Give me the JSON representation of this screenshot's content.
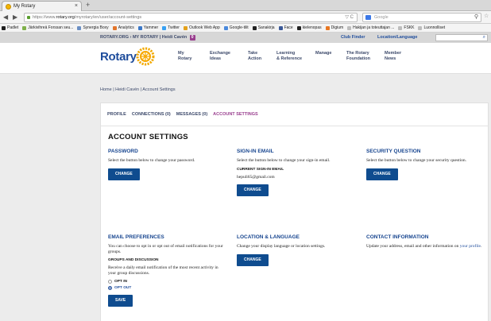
{
  "browser": {
    "tab_title": "My Rotary",
    "url_prefix": "https://www.",
    "url_host": "rotary.org",
    "url_path": "/myrotary/en/user/account-settings",
    "search_placeholder": "Google",
    "new_tab": "+",
    "close_tab": "×",
    "back": "◀",
    "forward": "▶",
    "reload": "C",
    "url_controls": "▽ C",
    "bookmarks": [
      {
        "label": "Padlet",
        "color": "#1f1f1f"
      },
      {
        "label": "Järkivihreä Forssan seu...",
        "color": "#7fb04a"
      },
      {
        "label": "Synergia Boxy",
        "color": "#6b8fc4"
      },
      {
        "label": "Analytics",
        "color": "#e2752b"
      },
      {
        "label": "Yammer",
        "color": "#3b78c8"
      },
      {
        "label": "Twitter",
        "color": "#38a1f3"
      },
      {
        "label": "Outlook Web App",
        "color": "#e4a11b"
      },
      {
        "label": "Google-tilit",
        "color": "#4a89dc"
      },
      {
        "label": "Sanakirja",
        "color": "#222222"
      },
      {
        "label": "Face",
        "color": "#3b5998"
      },
      {
        "label": "kielenopas",
        "color": "#222222"
      },
      {
        "label": "Digium",
        "color": "#e87722"
      },
      {
        "label": "Hakijan ja toteuttajan ...",
        "color": "#bdbdbd"
      },
      {
        "label": "FSKK",
        "color": "#bdbdbd"
      },
      {
        "label": "Luonnolliset",
        "color": "#bdbdbd"
      }
    ]
  },
  "site": {
    "topbar": {
      "rotary_org": "ROTARY.ORG",
      "separator": "›",
      "my_rotary": "MY ROTARY",
      "pipe": "|",
      "user": "Heidi Cavén",
      "badge": "0",
      "club_finder": "Club Finder",
      "location_language": "Location/Language",
      "search_icon": "⌕"
    },
    "logo": "Rotary",
    "menu": [
      {
        "line1": "My",
        "line2": "Rotary"
      },
      {
        "line1": "Exchange",
        "line2": "Ideas"
      },
      {
        "line1": "Take",
        "line2": "Action"
      },
      {
        "line1": "Learning",
        "line2": "& Reference"
      },
      {
        "line1": "Manage",
        "line2": ""
      },
      {
        "line1": "The Rotary",
        "line2": "Foundation"
      },
      {
        "line1": "Member",
        "line2": "News"
      }
    ]
  },
  "page": {
    "breadcrumb": "Home | Heidi Cavén | Account Settings",
    "tabs": [
      "PROFILE",
      "CONNECTIONS (0)",
      "MESSAGES (0)",
      "ACCOUNT SETTINGS"
    ],
    "title": "ACCOUNT SETTINGS",
    "password": {
      "heading": "PASSWORD",
      "text": "Select the button below to change your password.",
      "button": "CHANGE"
    },
    "signin_email": {
      "heading": "SIGN-IN EMAIL",
      "text": "Select the button below to change your sign-in email.",
      "current_label": "CURRENT SIGN-IN EMAIL",
      "current_value": "hepuli65@gmail.com",
      "button": "CHANGE"
    },
    "security_question": {
      "heading": "SECURITY QUESTION",
      "text": "Select the button below to change your security question.",
      "button": "CHANGE"
    },
    "email_prefs": {
      "heading": "EMAIL PREFERENCES",
      "text": "You can choose to opt in or opt out of email notifications for your groups.",
      "groups_label": "GROUPS AND DISCUSSION",
      "groups_text": "Receive a daily email notification of the most recent activity in your group discussions.",
      "opt_in": "OPT IN",
      "opt_out": "OPT OUT",
      "button": "SAVE"
    },
    "location_language": {
      "heading": "LOCATION & LANGUAGE",
      "text": "Change your display language or location settings.",
      "button": "CHANGE"
    },
    "contact": {
      "heading": "CONTACT INFORMATION",
      "text": "Update your address, email and other information on",
      "link": "your profile",
      "end": "."
    }
  }
}
